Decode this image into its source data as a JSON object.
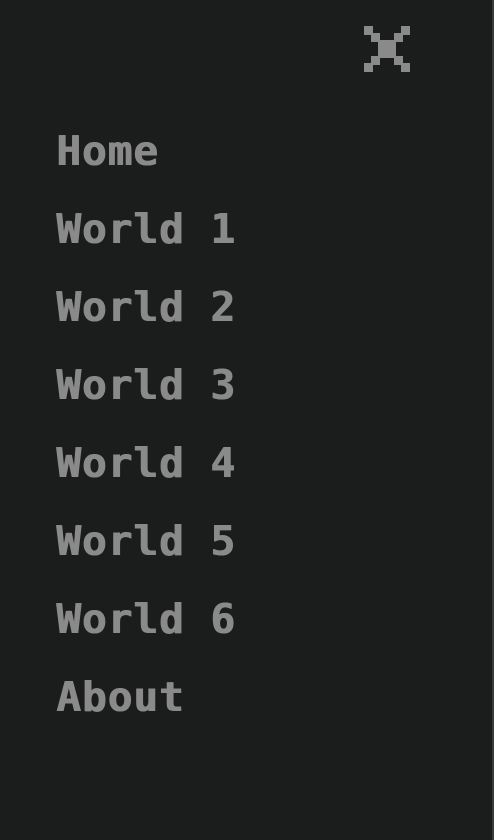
{
  "colors": {
    "background": "#1b1c1c",
    "text": "#8a8a8a",
    "border": "#3a3b3b"
  },
  "header": {
    "close_icon": "close-icon"
  },
  "menu": {
    "items": [
      {
        "label": "Home"
      },
      {
        "label": "World 1"
      },
      {
        "label": "World 2"
      },
      {
        "label": "World 3"
      },
      {
        "label": "World 4"
      },
      {
        "label": "World 5"
      },
      {
        "label": "World 6"
      },
      {
        "label": "About"
      }
    ]
  }
}
